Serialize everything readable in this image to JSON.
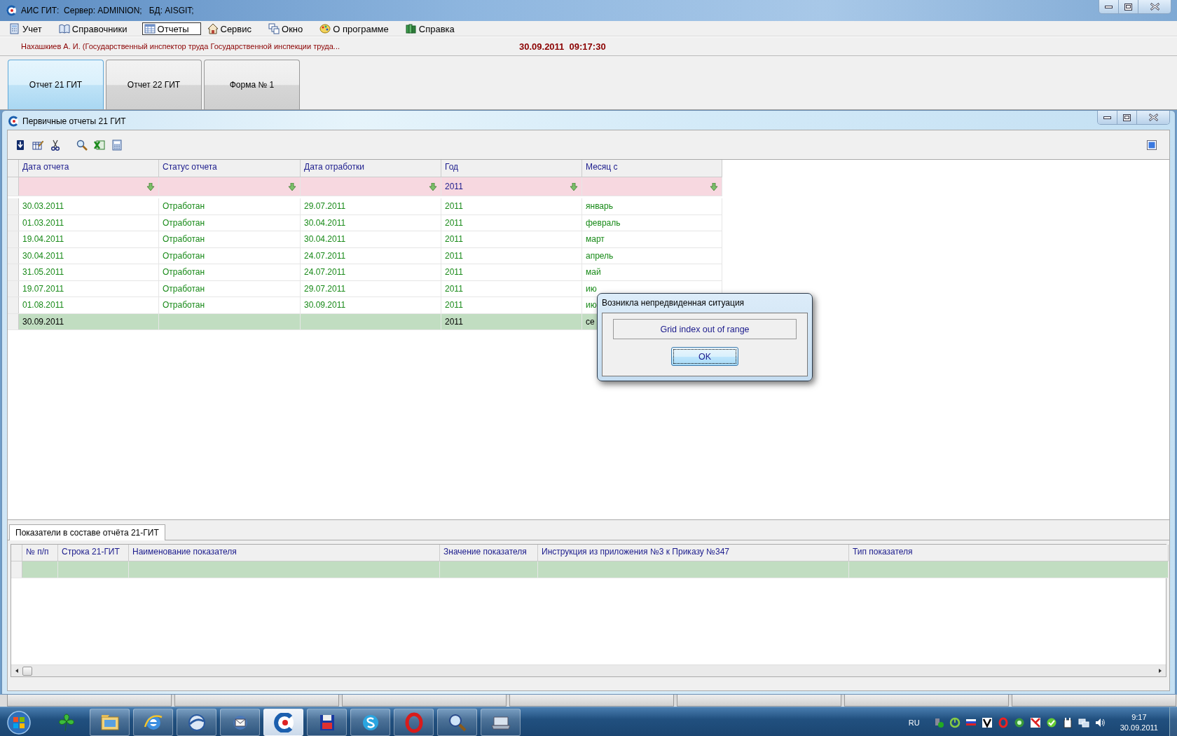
{
  "window": {
    "title": "АИС ГИТ:  Сервер: ADMINION;   БД: AISGIT;"
  },
  "menu": [
    {
      "label": "Учет",
      "selected": false
    },
    {
      "label": "Справочники",
      "selected": false
    },
    {
      "label": "Отчеты",
      "selected": true
    },
    {
      "label": "Сервис",
      "selected": false
    },
    {
      "label": "Окно",
      "selected": false
    },
    {
      "label": "О программе",
      "selected": false
    },
    {
      "label": "Справка",
      "selected": false
    }
  ],
  "user_info": "Нахашкиев А. И. (Государственный инспектор труда Государственной инспекции труда...",
  "datetime": "30.09.2011  09:17:30",
  "report_tabs": [
    {
      "label": "Отчет 21 ГИТ",
      "selected": true
    },
    {
      "label": "Отчет 22 ГИТ",
      "selected": false
    },
    {
      "label": "Форма № 1",
      "selected": false
    }
  ],
  "child_window": {
    "title": "Первичные отчеты 21 ГИТ"
  },
  "grid": {
    "columns": [
      {
        "title": "Дата отчета"
      },
      {
        "title": "Статус отчета"
      },
      {
        "title": "Дата отработки"
      },
      {
        "title": "Год",
        "filter": "2011"
      },
      {
        "title": "Месяц с"
      }
    ],
    "filter_row": true,
    "rows": [
      {
        "selected": false,
        "cells": [
          "30.03.2011",
          "Отработан",
          "29.07.2011",
          "2011",
          "январь"
        ]
      },
      {
        "selected": false,
        "cells": [
          "01.03.2011",
          "Отработан",
          "30.04.2011",
          "2011",
          "февраль"
        ]
      },
      {
        "selected": false,
        "cells": [
          "19.04.2011",
          "Отработан",
          "30.04.2011",
          "2011",
          "март"
        ]
      },
      {
        "selected": false,
        "cells": [
          "30.04.2011",
          "Отработан",
          "24.07.2011",
          "2011",
          "апрель"
        ]
      },
      {
        "selected": false,
        "cells": [
          "31.05.2011",
          "Отработан",
          "24.07.2011",
          "2011",
          "май"
        ]
      },
      {
        "selected": false,
        "cells": [
          "19.07.2011",
          "Отработан",
          "29.07.2011",
          "2011",
          "ию"
        ]
      },
      {
        "selected": false,
        "cells": [
          "01.08.2011",
          "Отработан",
          "30.09.2011",
          "2011",
          "ию"
        ]
      },
      {
        "selected": true,
        "cells": [
          "30.09.2011",
          null,
          null,
          "2011",
          "се"
        ]
      }
    ]
  },
  "detail_tabs": [
    {
      "label": "Показатели в составе отчёта 21-ГИТ",
      "selected": true
    }
  ],
  "detail_grid": {
    "columns": [
      {
        "title": "№ п/п"
      },
      {
        "title": "Строка 21-ГИТ"
      },
      {
        "title": "Наименование показателя"
      },
      {
        "title": "Значение показателя"
      },
      {
        "title": "Инструкция из приложения №3 к Приказу №347"
      },
      {
        "title": "Тип показателя"
      }
    ],
    "rows": [
      {
        "selected": true
      }
    ]
  },
  "dialog": {
    "title": "Возникла непредвиденная ситуация",
    "message": "Grid index out of range",
    "button": "OK"
  },
  "tray": {
    "language": "RU",
    "time": "9:17",
    "date": "30.09.2011"
  }
}
